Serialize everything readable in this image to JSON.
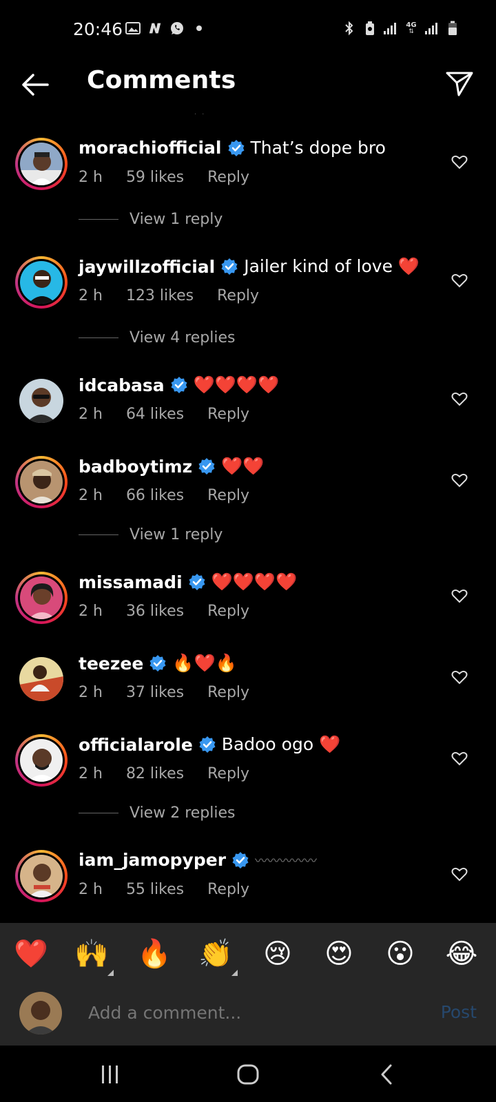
{
  "status": {
    "time": "20:46",
    "network": "4G"
  },
  "header": {
    "title": "Comments"
  },
  "comments": [
    {
      "user": "morachiofficial",
      "text": "That’s dope bro",
      "time": "2 h",
      "likes": "59 likes",
      "reply": "Reply",
      "ring": true
    },
    {
      "user": "jaywillzofficial",
      "text": "Jailer kind of love ❤️",
      "time": "2 h",
      "likes": "123 likes",
      "reply": "Reply",
      "ring": true
    },
    {
      "user": "idcabasa",
      "text": "❤️❤️❤️❤️",
      "time": "2 h",
      "likes": "64 likes",
      "reply": "Reply",
      "ring": false
    },
    {
      "user": "badboytimz",
      "text": "❤️❤️",
      "time": "2 h",
      "likes": "66 likes",
      "reply": "Reply",
      "ring": true
    },
    {
      "user": "missamadi",
      "text": "❤️❤️❤️❤️",
      "time": "2 h",
      "likes": "36 likes",
      "reply": "Reply",
      "ring": true
    },
    {
      "user": "teezee",
      "text": "🔥❤️🔥",
      "time": "2 h",
      "likes": "37 likes",
      "reply": "Reply",
      "ring": false
    },
    {
      "user": "officialarole",
      "text": "Badoo ogo ❤️",
      "time": "2 h",
      "likes": "82 likes",
      "reply": "Reply",
      "ring": true
    },
    {
      "user": "iam_jamopyper",
      "text": "〰〰〰〰〰",
      "time": "2 h",
      "likes": "55 likes",
      "reply": "Reply",
      "ring": true
    }
  ],
  "view_replies": [
    "View 1 reply",
    "View 4 replies",
    "View 1 reply",
    "View 2 replies"
  ],
  "emoji_bar": [
    "❤️",
    "🙌",
    "🔥",
    "👏",
    "😢",
    "😍",
    "😮",
    "😂"
  ],
  "composer": {
    "placeholder": "Add a comment...",
    "post_label": "Post"
  },
  "colors": {
    "background": "#000000",
    "verified": "#3897f0",
    "muted_text": "#a8a8a8",
    "post_disabled": "#26486d",
    "panel": "#262626"
  },
  "icons": {
    "back": "arrow-left-icon",
    "send": "paper-plane-icon",
    "verified": "verified-badge-icon",
    "like": "heart-outline-icon"
  }
}
